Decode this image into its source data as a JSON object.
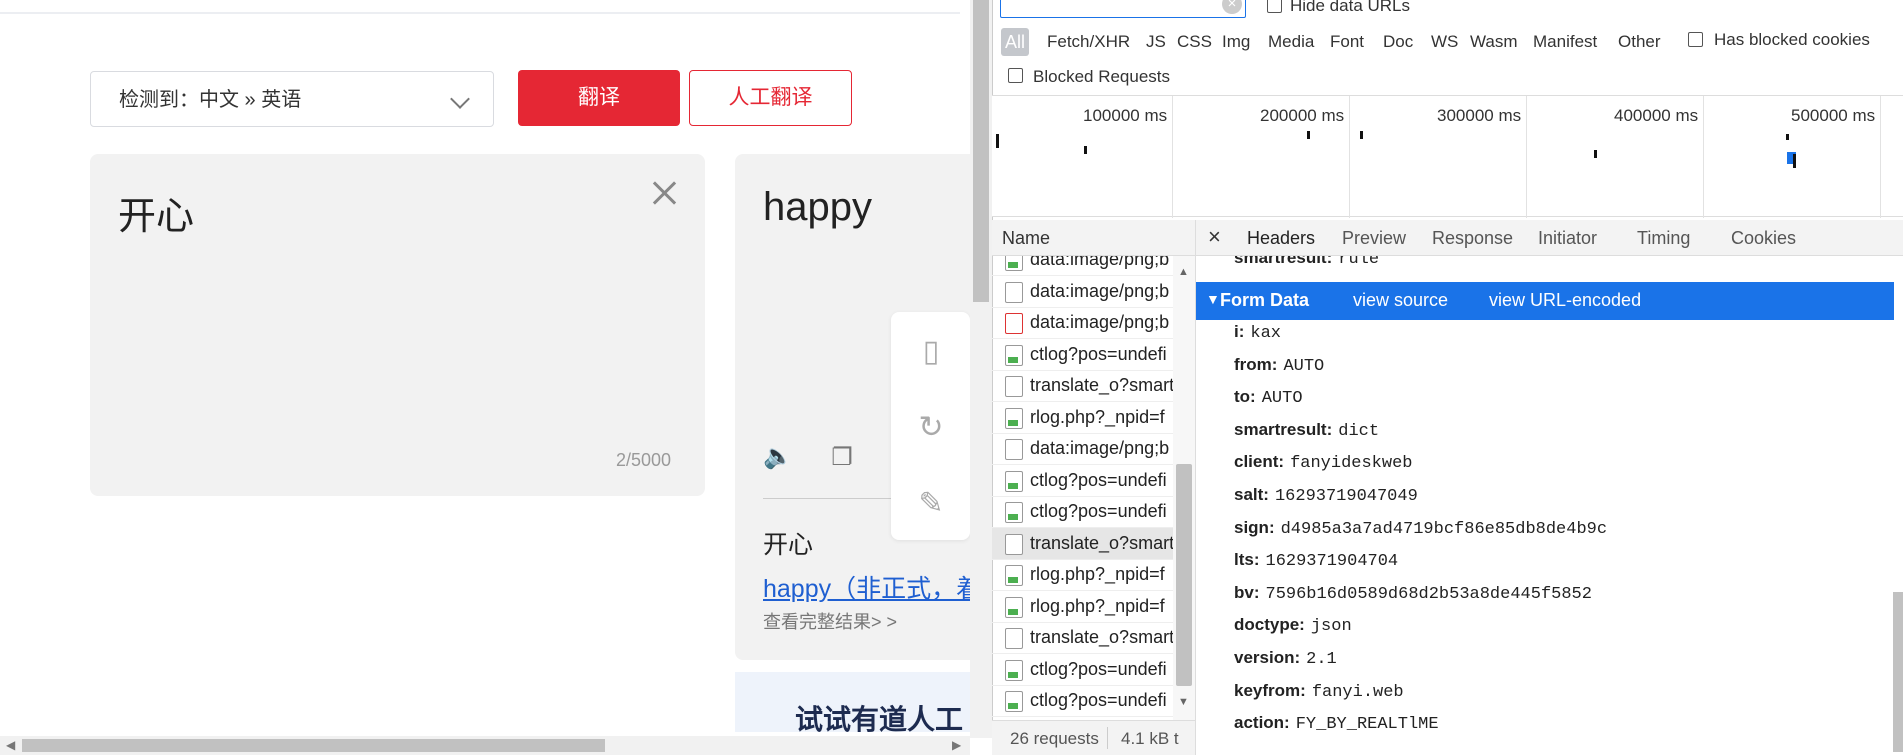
{
  "translator": {
    "lang_select": "检测到：中文 » 英语",
    "translate_button": "翻译",
    "human_translate_button": "人工翻译",
    "source_text": "开心",
    "char_count": "2/5000",
    "result_text": "happy",
    "dict_word": "开心",
    "dict_meaning": "happy（非正式，着",
    "view_full": "查看完整结果> >",
    "promo_text": "试试有道人工"
  },
  "devtools": {
    "filter_value": "",
    "hide_data_urls": "Hide data URLs",
    "type_filters": [
      "All",
      "Fetch/XHR",
      "JS",
      "CSS",
      "Img",
      "Media",
      "Font",
      "Doc",
      "WS",
      "Wasm",
      "Manifest",
      "Other"
    ],
    "has_blocked_cookies": "Has blocked cookies",
    "blocked_requests": "Blocked Requests",
    "timeline_labels": [
      "100000 ms",
      "200000 ms",
      "300000 ms",
      "400000 ms",
      "500000 ms"
    ],
    "name_header": "Name",
    "requests": [
      {
        "name": "data:image/png;b",
        "icon": "img"
      },
      {
        "name": "data:image/png;b",
        "icon": "doc"
      },
      {
        "name": "data:image/png;b",
        "icon": "red"
      },
      {
        "name": "ctlog?pos=undefi",
        "icon": "img"
      },
      {
        "name": "translate_o?smart",
        "icon": "doc"
      },
      {
        "name": "rlog.php?_npid=f",
        "icon": "img"
      },
      {
        "name": "data:image/png;b",
        "icon": "doc"
      },
      {
        "name": "ctlog?pos=undefi",
        "icon": "img"
      },
      {
        "name": "ctlog?pos=undefi",
        "icon": "img"
      },
      {
        "name": "translate_o?smart",
        "icon": "doc",
        "selected": true
      },
      {
        "name": "rlog.php?_npid=f",
        "icon": "img"
      },
      {
        "name": "rlog.php?_npid=f",
        "icon": "img"
      },
      {
        "name": "translate_o?smart",
        "icon": "doc"
      },
      {
        "name": "ctlog?pos=undefi",
        "icon": "img"
      },
      {
        "name": "ctlog?pos=undefi",
        "icon": "img"
      }
    ],
    "status": {
      "requests": "26 requests",
      "transferred": "4.1 kB t"
    },
    "tabs": [
      "Headers",
      "Preview",
      "Response",
      "Initiator",
      "Timing",
      "Cookies"
    ],
    "prev_row": {
      "key": "smartresult:",
      "value": "rule"
    },
    "form_data": {
      "title": "Form Data",
      "view_source": "view source",
      "view_url_encoded": "view URL-encoded",
      "fields": [
        {
          "key": "i:",
          "value": "kax"
        },
        {
          "key": "from:",
          "value": "AUTO"
        },
        {
          "key": "to:",
          "value": "AUTO"
        },
        {
          "key": "smartresult:",
          "value": "dict"
        },
        {
          "key": "client:",
          "value": "fanyideskweb"
        },
        {
          "key": "salt:",
          "value": "16293719047049"
        },
        {
          "key": "sign:",
          "value": "d4985a3a7ad4719bcf86e85db8de4b9c"
        },
        {
          "key": "lts:",
          "value": "1629371904704"
        },
        {
          "key": "bv:",
          "value": "7596b16d0589d68d2b53a8de445f5852"
        },
        {
          "key": "doctype:",
          "value": "json"
        },
        {
          "key": "version:",
          "value": "2.1"
        },
        {
          "key": "keyfrom:",
          "value": "fanyi.web"
        },
        {
          "key": "action:",
          "value": "FY_BY_REALTlME"
        }
      ]
    }
  }
}
